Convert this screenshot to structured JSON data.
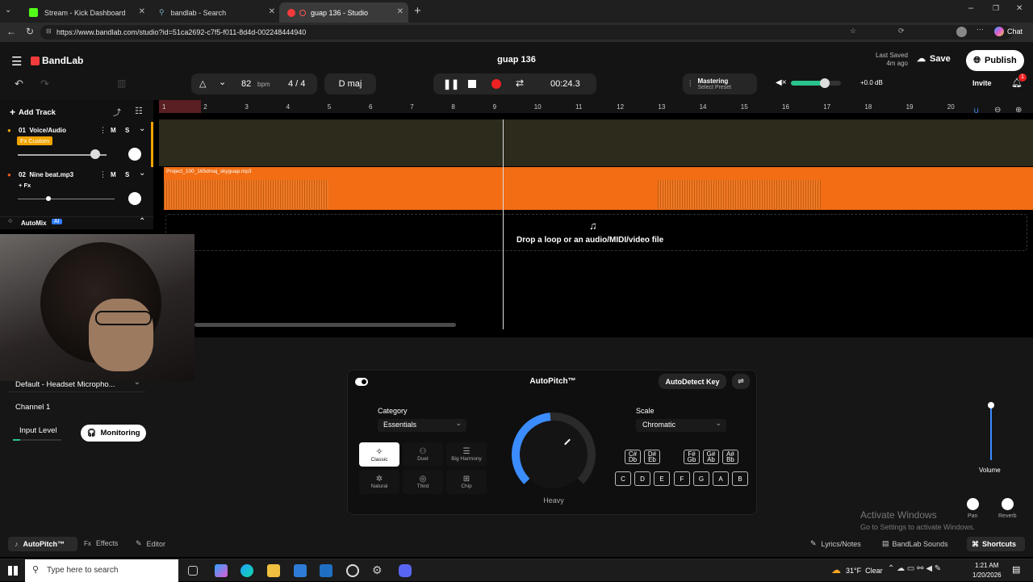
{
  "browser": {
    "tabs": [
      {
        "label": "Stream - Kick Dashboard",
        "icon": "kick-icon"
      },
      {
        "label": "bandlab - Search",
        "icon": "search-icon"
      },
      {
        "label": "guap 136 - Studio",
        "icon": "bandlab-icon"
      }
    ],
    "url": "https://www.bandlab.com/studio?id=51ca2692-c7f5-f011-8d4d-002248444940",
    "chat_label": "Chat"
  },
  "app": {
    "logo": "BandLab",
    "project_title": "guap 136",
    "last_saved_label": "Last Saved",
    "last_saved_time": "4m ago",
    "save_label": "Save",
    "publish_label": "Publish",
    "invite_label": "Invite",
    "notification_count": "1",
    "bpm": "82",
    "bpm_unit": "bpm",
    "time_signature": "4 / 4",
    "key": "D maj",
    "time": "00:24.3",
    "mastering_label": "Mastering",
    "mastering_preset": "Select Preset",
    "volume_db": "+0.0 dB"
  },
  "tracks": {
    "add_track": "Add Track",
    "list": [
      {
        "name": "01  Voice/Audio",
        "fx": "Fx Custom",
        "mute": "M",
        "solo": "S"
      },
      {
        "name": "02  Nine beat.mp3",
        "fx": "+ Fx",
        "mute": "M",
        "solo": "S"
      }
    ],
    "automix": "AutoMix",
    "automix_badge": "AI",
    "clip_name": "Project_100_165dmaj_skyguap.mp3",
    "drop_text": "Drop a loop or an audio/MIDI/video file",
    "ruler": [
      "1",
      "2",
      "3",
      "4",
      "5",
      "6",
      "7",
      "8",
      "9",
      "10",
      "11",
      "12",
      "13",
      "14",
      "15",
      "16",
      "17",
      "18",
      "19",
      "20"
    ]
  },
  "input": {
    "device": "Default - Headset Micropho...",
    "channel": "Channel 1",
    "input_level": "Input Level",
    "monitoring": "Monitoring"
  },
  "autopitch": {
    "title": "AutoPitch™",
    "autodetect": "AutoDetect Key",
    "category_label": "Category",
    "category_value": "Essentials",
    "scale_label": "Scale",
    "scale_value": "Chromatic",
    "knob_label": "Heavy",
    "modes": [
      "Classic",
      "Duet",
      "Big Harmony",
      "Natural",
      "Third",
      "Chip"
    ],
    "sharps": [
      [
        "C#",
        "Db"
      ],
      [
        "D#",
        "Eb"
      ],
      [
        "F#",
        "Gb"
      ],
      [
        "G#",
        "Ab"
      ],
      [
        "A#",
        "Bb"
      ]
    ],
    "naturals": [
      "C",
      "D",
      "E",
      "F",
      "G",
      "A",
      "B"
    ]
  },
  "mixer": {
    "volume": "Volume",
    "pan": "Pan",
    "reverb": "Reverb"
  },
  "footer": {
    "autopitch_tab": "AutoPitch™",
    "effects_tab": "Effects",
    "editor_tab": "Editor",
    "lyrics": "Lyrics/Notes",
    "sounds": "BandLab Sounds",
    "shortcuts": "Shortcuts",
    "activate_title": "Activate Windows",
    "activate_sub": "Go to Settings to activate Windows."
  },
  "taskbar": {
    "search_placeholder": "Type here to search",
    "weather": "31°F  Clear",
    "time": "1:21 AM",
    "date": "1/20/2026"
  }
}
